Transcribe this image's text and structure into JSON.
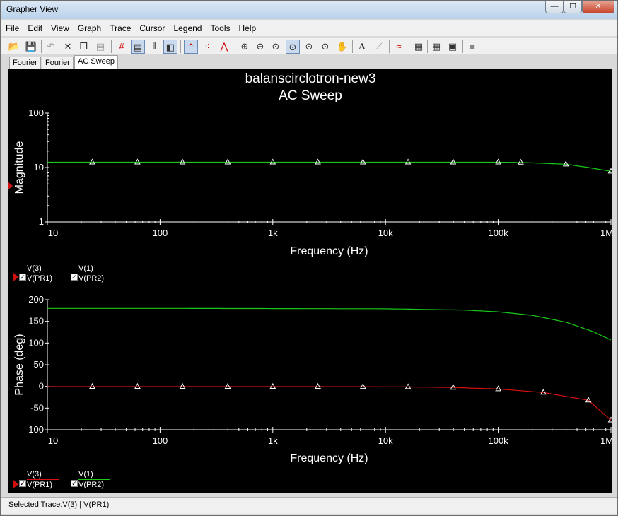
{
  "window": {
    "title": "Grapher View",
    "close_glyph": "✕",
    "min_glyph": "—",
    "max_glyph": "☐"
  },
  "menu": [
    "File",
    "Edit",
    "View",
    "Graph",
    "Trace",
    "Cursor",
    "Legend",
    "Tools",
    "Help"
  ],
  "toolbar_icons": [
    "open-icon",
    "save-icon",
    "undo-icon",
    "cut-icon",
    "copy-icon",
    "paste-icon",
    "grid-icon",
    "toggle-legend-icon",
    "cursors-icon",
    "reverse-colors-icon",
    "show-select-marks-icon",
    "select-marks-icon",
    "lines-only-icon",
    "zoom-in-icon",
    "zoom-out-icon",
    "zoom-fit-icon",
    "zoom-x-icon",
    "zoom-y-icon",
    "zoom-area-icon",
    "pan-icon",
    "text-icon",
    "line-icon",
    "overlay-traces-icon",
    "export-icon",
    "properties-icon",
    "stop-icon"
  ],
  "tabs": [
    "Fourier",
    "Fourier",
    "AC Sweep"
  ],
  "plot": {
    "title1": "balanscirclotron-new3",
    "title2": "AC Sweep"
  },
  "chart_data": [
    {
      "type": "line",
      "ylabel": "Magnitude",
      "xlabel": "Frequency (Hz)",
      "xscale": "log",
      "yscale": "log",
      "xlim": [
        10,
        1000000
      ],
      "ylim": [
        1,
        100
      ],
      "x_ticks": [
        "10",
        "100",
        "1k",
        "10k",
        "100k",
        "1M"
      ],
      "y_ticks": [
        "100",
        "10",
        "1"
      ],
      "series": [
        {
          "name": "V(1) / V(PR2)",
          "color": "#19c819",
          "markers": true,
          "x": [
            10,
            25,
            63,
            158,
            398,
            1000,
            2512,
            6310,
            15849,
            39811,
            100000,
            158489,
            398107,
            1000000
          ],
          "y": [
            12.5,
            12.5,
            12.5,
            12.5,
            12.5,
            12.5,
            12.5,
            12.5,
            12.5,
            12.5,
            12.5,
            12.4,
            11.5,
            8.5
          ]
        }
      ]
    },
    {
      "type": "line",
      "ylabel": "Phase (deg)",
      "xlabel": "Frequency (Hz)",
      "xscale": "log",
      "xlim": [
        10,
        1000000
      ],
      "ylim": [
        -100,
        200
      ],
      "x_ticks": [
        "10",
        "100",
        "1k",
        "10k",
        "100k",
        "1M"
      ],
      "y_ticks": [
        "200",
        "150",
        "100",
        "50",
        "0",
        "-50",
        "-100"
      ],
      "series": [
        {
          "name": "V(1) / V(PR2)",
          "color": "#19c819",
          "markers": false,
          "x": [
            10,
            100,
            1000,
            10000,
            50000,
            100000,
            200000,
            400000,
            700000,
            1000000
          ],
          "y": [
            180,
            180,
            179.5,
            179,
            176,
            172,
            164,
            148,
            126,
            107
          ]
        },
        {
          "name": "V(3) / V(PR1)",
          "color": "#d81010",
          "markers": true,
          "x": [
            10,
            25,
            63,
            158,
            398,
            1000,
            2512,
            6310,
            15849,
            39811,
            100000,
            251189,
            630957,
            1000000
          ],
          "y": [
            -0.5,
            -0.5,
            -0.5,
            -0.5,
            -0.5,
            -0.5,
            -0.6,
            -0.8,
            -1.2,
            -2.5,
            -6,
            -14,
            -32,
            -78
          ]
        }
      ]
    }
  ],
  "legend_top": {
    "a_top": "V(3)",
    "a_bottom": "V(PR1)",
    "b_top": "V(1)",
    "b_bottom": "V(PR2)"
  },
  "legend_bottom": {
    "a_top": "V(3)",
    "a_bottom": "V(PR1)",
    "b_top": "V(1)",
    "b_bottom": "V(PR2)"
  },
  "status": "Selected Trace:V(3) | V(PR1)"
}
